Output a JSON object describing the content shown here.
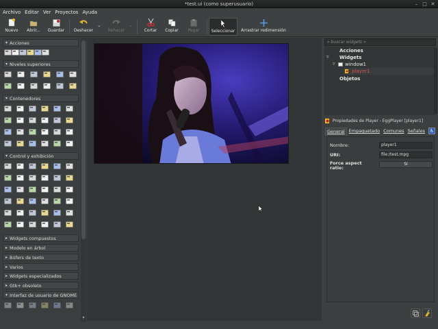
{
  "window": {
    "title": "*test.ui (como superusuario)"
  },
  "menu": [
    "Archivo",
    "Editar",
    "Ver",
    "Proyectos",
    "Ayuda"
  ],
  "toolbar": {
    "nuevo": "Nuevo",
    "abrir": "Abrir...",
    "guardar": "Guardar",
    "deshacer": "Deshacer",
    "rehacer": "Rehacer",
    "cortar": "Cortar",
    "copiar": "Copiar",
    "pegar": "Pegar",
    "seleccionar": "Seleccionar",
    "arrastrar": "Arrastrar redimensión"
  },
  "palette": {
    "sections": [
      "Acciones",
      "Niveles superiores",
      "Contenedores",
      "Control y exhibición",
      "Widgets compuestos",
      "Modelo en árbol",
      "Búfers de texto",
      "Varios",
      "Widgets especializados",
      "Gtk+ obsoleto",
      "Interfaz de usuario de GNOME"
    ]
  },
  "inspector": {
    "search_placeholder": "« buscar widgets »",
    "tree": {
      "acciones": "Acciones",
      "widgets": "Widgets",
      "window1": "window1",
      "player1": "player1",
      "objetos": "Objetos"
    }
  },
  "properties": {
    "header": "Propiedades de Player - EggPlayer [player1]",
    "tabs": [
      "General",
      "Empaquetado",
      "Comunes",
      "Señales"
    ],
    "nombre_label": "Nombre:",
    "nombre_value": "player1",
    "uri_label": "URI:",
    "uri_value": "file:/test.mpg",
    "aspect_label": "Force aspect ratio:",
    "aspect_value": "Sí"
  },
  "colors": {
    "bg": "#3c3f40",
    "panel": "#333637",
    "accent_red": "#cc2a2a"
  }
}
